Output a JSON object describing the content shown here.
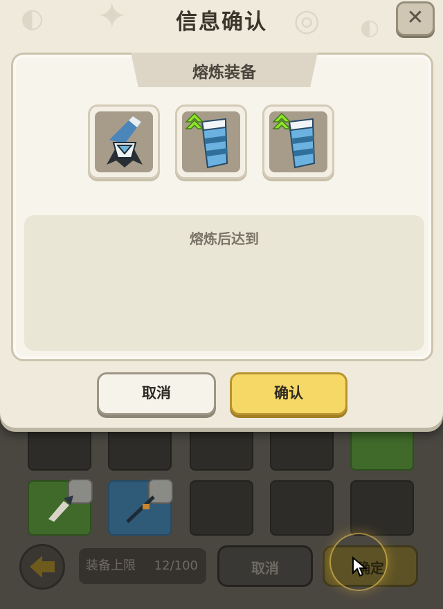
{
  "dialog": {
    "title": "信息确认",
    "close_icon": "close-x-icon",
    "section_title": "熔炼装备",
    "items": [
      {
        "name": "blue-wing-cape",
        "icon": "cape-icon",
        "upgrade_arrow": false
      },
      {
        "name": "blue-striped-bracer",
        "icon": "bracer-icon",
        "upgrade_arrow": true
      },
      {
        "name": "blue-striped-bracer",
        "icon": "bracer-icon",
        "upgrade_arrow": true
      }
    ],
    "result_label": "熔炼后达到",
    "cancel_label": "取消",
    "confirm_label": "确认"
  },
  "background": {
    "limit_label": "装备上限",
    "limit_count": "12/100",
    "cancel_label": "取消",
    "confirm_label": "确定"
  },
  "colors": {
    "panel_bg": "#efeadc",
    "confirm_yellow": "#f6d867",
    "upgrade_green": "#7ed321"
  }
}
